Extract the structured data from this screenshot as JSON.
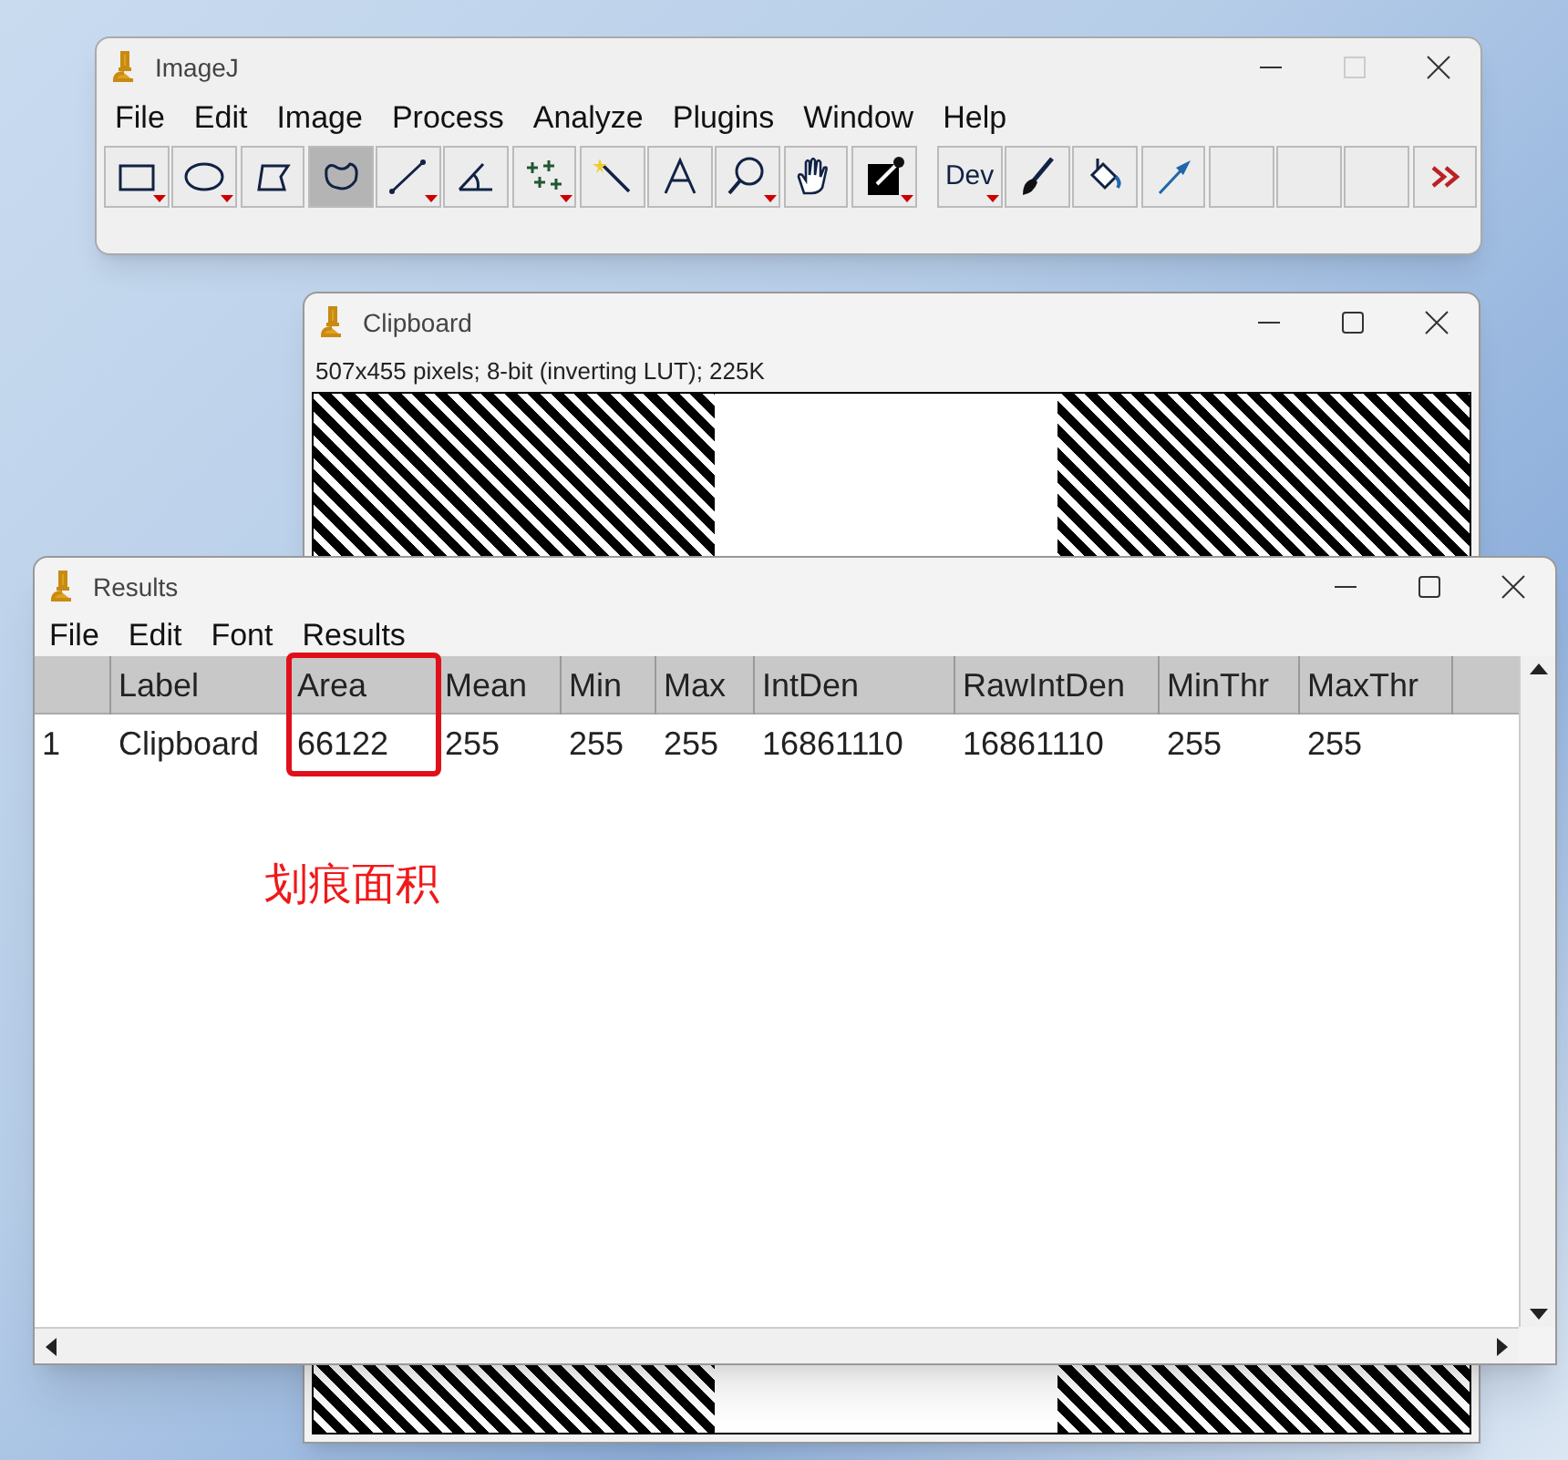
{
  "imagej_window": {
    "title": "ImageJ",
    "menu": [
      "File",
      "Edit",
      "Image",
      "Process",
      "Analyze",
      "Plugins",
      "Window",
      "Help"
    ],
    "tools": [
      {
        "kind": "rectangle",
        "menu": true,
        "selected": false
      },
      {
        "kind": "oval",
        "menu": true,
        "selected": false
      },
      {
        "kind": "polygon",
        "menu": false,
        "selected": false
      },
      {
        "kind": "freehand",
        "menu": false,
        "selected": true
      },
      {
        "kind": "line",
        "menu": true,
        "selected": false
      },
      {
        "kind": "angle",
        "menu": false,
        "selected": false
      },
      {
        "kind": "points",
        "menu": true,
        "selected": false
      },
      {
        "kind": "wand",
        "menu": false,
        "selected": false
      },
      {
        "kind": "text",
        "menu": false,
        "selected": false
      },
      {
        "kind": "zoom",
        "menu": true,
        "selected": false
      },
      {
        "kind": "hand",
        "menu": false,
        "selected": false
      },
      {
        "kind": "dropper",
        "menu": true,
        "selected": false
      },
      {
        "kind": "gap"
      },
      {
        "kind": "dev",
        "label": "Dev",
        "menu": true,
        "selected": false
      },
      {
        "kind": "brush",
        "menu": false,
        "selected": false
      },
      {
        "kind": "bucket",
        "menu": false,
        "selected": false
      },
      {
        "kind": "arrow",
        "menu": false,
        "selected": false
      },
      {
        "kind": "empty",
        "menu": false,
        "selected": false
      },
      {
        "kind": "empty",
        "menu": false,
        "selected": false
      },
      {
        "kind": "empty",
        "menu": false,
        "selected": false
      },
      {
        "kind": "more",
        "menu": false,
        "selected": false
      }
    ]
  },
  "clipboard_window": {
    "title": "Clipboard",
    "info": "507x455 pixels; 8-bit (inverting LUT); 225K"
  },
  "results_window": {
    "title": "Results",
    "menu": [
      "File",
      "Edit",
      "Font",
      "Results"
    ],
    "columns": [
      {
        "highlighted": false
      },
      {
        "label": "Label",
        "highlighted": false
      },
      {
        "label": "Area",
        "highlighted": true
      },
      {
        "label": "Mean",
        "highlighted": false
      },
      {
        "label": "Min",
        "highlighted": false
      },
      {
        "label": "Max",
        "highlighted": false
      },
      {
        "label": "IntDen",
        "highlighted": false
      },
      {
        "label": "RawIntDen",
        "highlighted": false
      },
      {
        "label": "MinThr",
        "highlighted": false
      },
      {
        "label": "MaxThr",
        "highlighted": false
      }
    ],
    "rows": [
      [
        "1",
        "Clipboard",
        "66122",
        "255",
        "255",
        "255",
        "16861110",
        "16861110",
        "255",
        "255"
      ]
    ],
    "annotation": "划痕面积"
  }
}
